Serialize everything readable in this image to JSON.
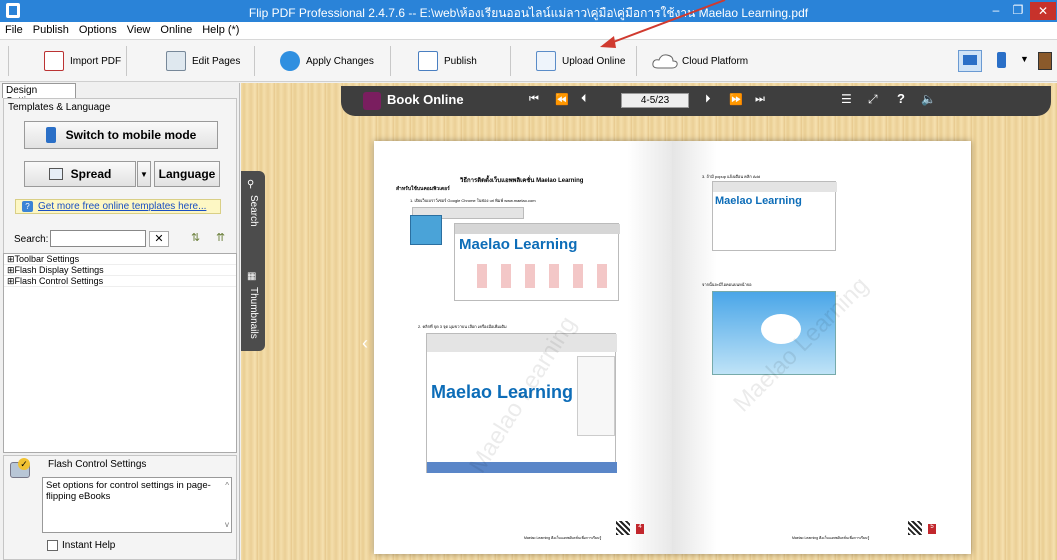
{
  "title": "Flip PDF Professional 2.4.7.6 -- E:\\web\\ห้องเรียนออนไลน์แม่ลาว\\คู่มือ\\คู่มือการใช้งาน Maelao Learning.pdf",
  "window_buttons": {
    "minimize": "–",
    "maximize": "❐",
    "close": "✕"
  },
  "menu": [
    "File",
    "Publish",
    "Options",
    "View",
    "Online",
    "Help (*)"
  ],
  "toolbar": {
    "import_pdf": "Import PDF",
    "edit_pages": "Edit Pages",
    "apply_changes": "Apply Changes",
    "publish": "Publish",
    "upload_online": "Upload Online",
    "cloud_platform": "Cloud Platform"
  },
  "left": {
    "tab": "Design Settings",
    "group_title": "Templates & Language",
    "mobile_btn": "Switch to mobile mode",
    "spread_btn": "Spread",
    "language_btn": "Language",
    "more_templates": "Get more free online templates here...",
    "search_label": "Search:",
    "search_value": "",
    "tree": [
      "⊞Toolbar Settings",
      "⊞Flash Display Settings",
      "⊞Flash Control Settings"
    ],
    "help_title": "Flash Control Settings",
    "help_text": "Set options for control settings in page-flipping eBooks",
    "instant_help": "Instant Help"
  },
  "book": {
    "logo": "Book Online",
    "page_field": "4-5/23",
    "side_search": "Search",
    "side_thumbnails": "Thumbnails",
    "left_heading": "วิธีการติดตั้งเว็บแอพพลิเคชั่น Maelao Learning",
    "left_sub": "สำหรับใช้บนคอมพิวเตอร์",
    "left_step1": "1. เปิดเว็บเบราว์เซอร์ Google Chrome ในช่อง url พิมพ์ www.maelao.com",
    "left_step2": "2. คลิกที่ จุด 3 จุด มุมขวาบน เลือก เครื่องมือเพิ่มเติม",
    "right_step3": "3. ถ้ามี popup แจ้งเตือน คลิก Add",
    "right_note": "จากนั้นจะมีไอคอนบนหน้าจอ",
    "maelao_text": "Maelao Learning",
    "footer": "Maelao Learning คือเว็บแอพพลิเคชั่นเพื่อการเรียนรู้",
    "page_left": "4",
    "page_right": "5",
    "watermark": "Maelao Learning"
  },
  "colors": {
    "titlebar": "#2a83d8",
    "accent": "#e0463e"
  }
}
